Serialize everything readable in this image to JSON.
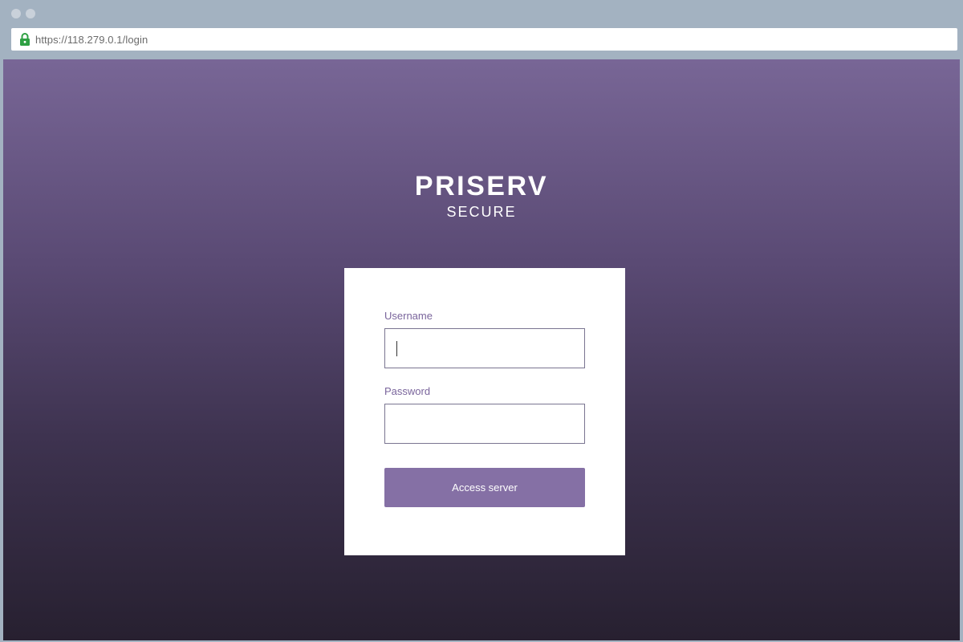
{
  "browser": {
    "url": "https://118.279.0.1/login",
    "secure_icon": "lock-icon",
    "secure_color": "#2ea043"
  },
  "brand": {
    "title": "PRISERV",
    "subtitle": "SECURE"
  },
  "login_form": {
    "username_label": "Username",
    "username_value": "",
    "password_label": "Password",
    "password_value": "",
    "submit_label": "Access server"
  },
  "colors": {
    "accent": "#8570a5",
    "label": "#7a659c",
    "background_top": "#786696",
    "background_bottom": "#272030"
  }
}
